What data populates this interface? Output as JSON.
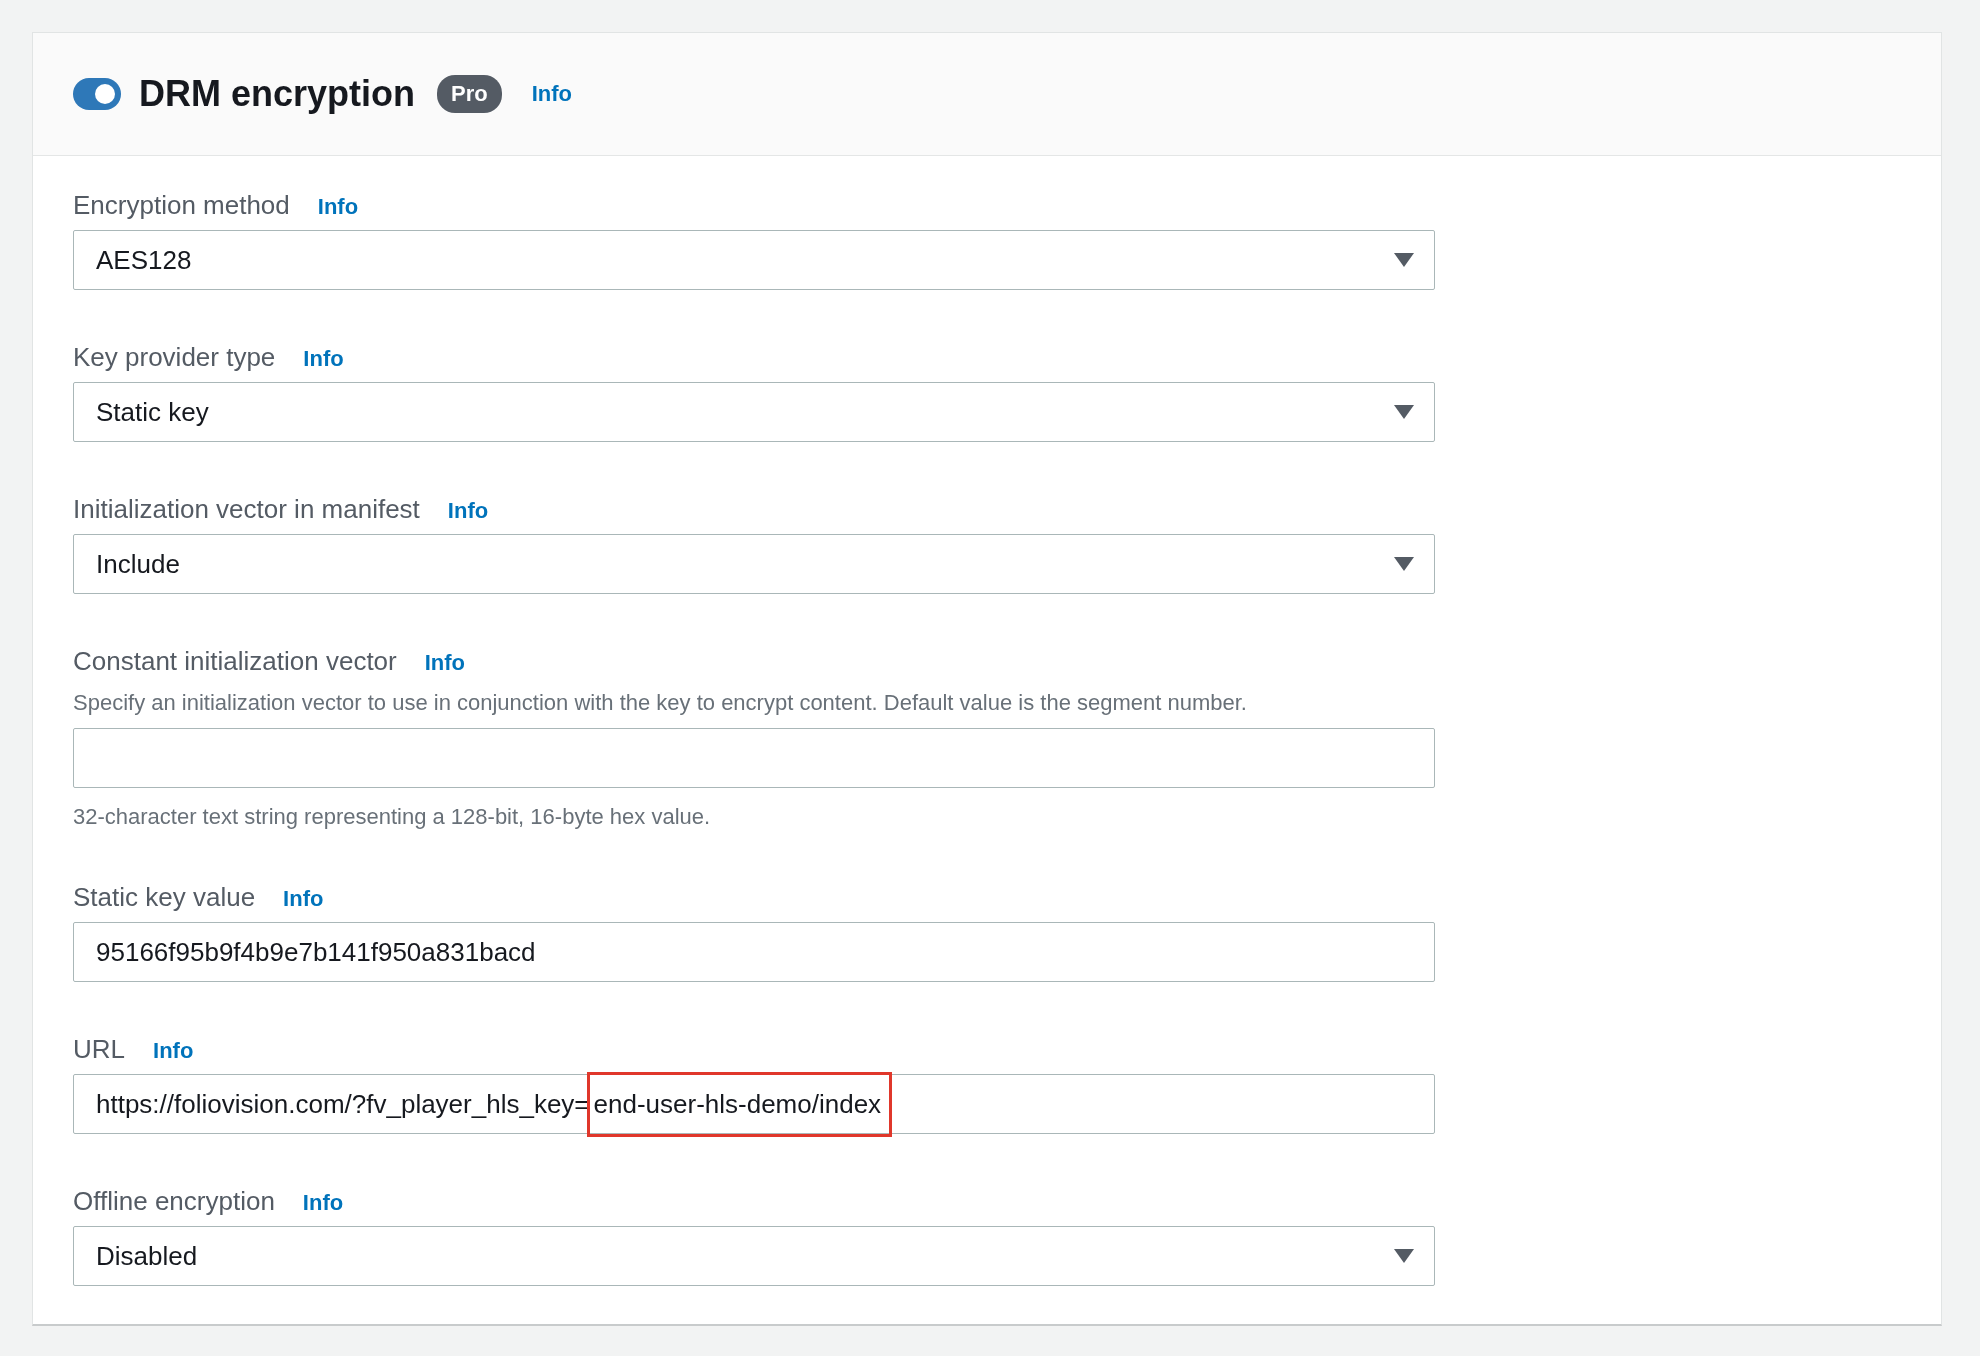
{
  "header": {
    "toggle_on": true,
    "title": "DRM encryption",
    "badge": "Pro",
    "info": "Info"
  },
  "fields": [
    {
      "kind": "select",
      "label": "Encryption method",
      "info": "Info",
      "value": "AES128"
    },
    {
      "kind": "select",
      "label": "Key provider type",
      "info": "Info",
      "value": "Static key"
    },
    {
      "kind": "select",
      "label": "Initialization vector in manifest",
      "info": "Info",
      "value": "Include"
    },
    {
      "kind": "input",
      "label": "Constant initialization vector",
      "info": "Info",
      "description": "Specify an initialization vector to use in conjunction with the key to encrypt content. Default value is the segment number.",
      "hint": "32-character text string representing a 128-bit, 16-byte hex value."
    },
    {
      "kind": "input",
      "label": "Static key value",
      "info": "Info",
      "value_parts": [
        {
          "text": "95166f95b9f4b9e7b141f950a831bacd",
          "highlighted": false
        }
      ]
    },
    {
      "kind": "input",
      "label": "URL",
      "info": "Info",
      "value_parts": [
        {
          "text": "https://foliovision.com/?fv_player_hls_key=",
          "highlighted": false
        },
        {
          "text": "end-user-hls-demo/index",
          "highlighted": true
        }
      ]
    },
    {
      "kind": "select",
      "label": "Offline encryption",
      "info": "Info",
      "value": "Disabled"
    }
  ]
}
